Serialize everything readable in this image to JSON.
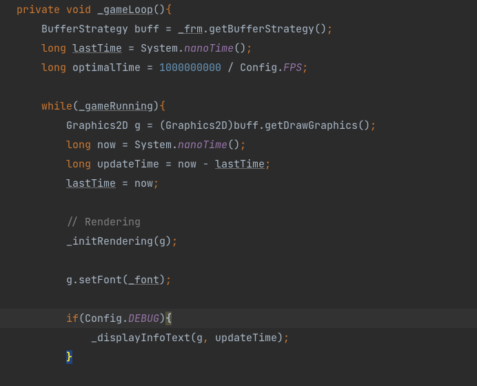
{
  "lines": [
    {
      "cls": "",
      "segs": [
        {
          "c": "kw",
          "t": "private "
        },
        {
          "c": "kw",
          "t": "void "
        },
        {
          "c": "mut",
          "t": "_gameLoop"
        },
        {
          "c": "plain",
          "t": "()"
        },
        {
          "c": "semi",
          "t": "{"
        }
      ]
    },
    {
      "cls": "",
      "segs": [
        {
          "c": "plain",
          "t": "    BufferStrategy buff = "
        },
        {
          "c": "field",
          "t": "_frm"
        },
        {
          "c": "plain",
          "t": ".getBufferStrategy()"
        },
        {
          "c": "semi",
          "t": ";"
        }
      ]
    },
    {
      "cls": "",
      "segs": [
        {
          "c": "plain",
          "t": "    "
        },
        {
          "c": "kw",
          "t": "long "
        },
        {
          "c": "mut",
          "t": "lastTime"
        },
        {
          "c": "plain",
          "t": " = System."
        },
        {
          "c": "static",
          "t": "nanoTime"
        },
        {
          "c": "plain",
          "t": "()"
        },
        {
          "c": "semi",
          "t": ";"
        }
      ]
    },
    {
      "cls": "",
      "segs": [
        {
          "c": "plain",
          "t": "    "
        },
        {
          "c": "kw",
          "t": "long "
        },
        {
          "c": "plain",
          "t": "optimalTime = "
        },
        {
          "c": "num",
          "t": "1000000000 "
        },
        {
          "c": "plain",
          "t": "/ Config."
        },
        {
          "c": "static",
          "t": "FPS"
        },
        {
          "c": "semi",
          "t": ";"
        }
      ]
    },
    {
      "cls": "",
      "segs": [
        {
          "c": "plain",
          "t": ""
        }
      ]
    },
    {
      "cls": "",
      "segs": [
        {
          "c": "plain",
          "t": "    "
        },
        {
          "c": "kw",
          "t": "while"
        },
        {
          "c": "plain",
          "t": "("
        },
        {
          "c": "field",
          "t": "_gameRunning"
        },
        {
          "c": "plain",
          "t": ")"
        },
        {
          "c": "semi",
          "t": "{"
        }
      ]
    },
    {
      "cls": "",
      "segs": [
        {
          "c": "plain",
          "t": "        Graphics2D g = (Graphics2D)buff.getDrawGraphics()"
        },
        {
          "c": "semi",
          "t": ";"
        }
      ]
    },
    {
      "cls": "",
      "segs": [
        {
          "c": "plain",
          "t": "        "
        },
        {
          "c": "kw",
          "t": "long "
        },
        {
          "c": "plain",
          "t": "now = System."
        },
        {
          "c": "static",
          "t": "nanoTime"
        },
        {
          "c": "plain",
          "t": "()"
        },
        {
          "c": "semi",
          "t": ";"
        }
      ]
    },
    {
      "cls": "",
      "segs": [
        {
          "c": "plain",
          "t": "        "
        },
        {
          "c": "kw",
          "t": "long "
        },
        {
          "c": "plain",
          "t": "updateTime = now - "
        },
        {
          "c": "mut",
          "t": "lastTime"
        },
        {
          "c": "semi",
          "t": ";"
        }
      ]
    },
    {
      "cls": "",
      "segs": [
        {
          "c": "plain",
          "t": "        "
        },
        {
          "c": "mut",
          "t": "lastTime"
        },
        {
          "c": "plain",
          "t": " = now"
        },
        {
          "c": "semi",
          "t": ";"
        }
      ]
    },
    {
      "cls": "",
      "segs": [
        {
          "c": "plain",
          "t": ""
        }
      ]
    },
    {
      "cls": "",
      "segs": [
        {
          "c": "plain",
          "t": "        "
        },
        {
          "c": "comment",
          "t": "// Rendering"
        }
      ]
    },
    {
      "cls": "",
      "segs": [
        {
          "c": "plain",
          "t": "        _initRendering(g)"
        },
        {
          "c": "semi",
          "t": ";"
        }
      ]
    },
    {
      "cls": "",
      "segs": [
        {
          "c": "plain",
          "t": ""
        }
      ]
    },
    {
      "cls": "",
      "segs": [
        {
          "c": "plain",
          "t": "        g.setFont("
        },
        {
          "c": "field",
          "t": "_font"
        },
        {
          "c": "plain",
          "t": ")"
        },
        {
          "c": "semi",
          "t": ";"
        }
      ]
    },
    {
      "cls": "",
      "segs": [
        {
          "c": "plain",
          "t": ""
        }
      ]
    },
    {
      "cls": "highlight",
      "segs": [
        {
          "c": "plain",
          "t": "        "
        },
        {
          "c": "kw",
          "t": "if"
        },
        {
          "c": "plain",
          "t": "(Config."
        },
        {
          "c": "static",
          "t": "DEBUG"
        },
        {
          "c": "plain",
          "t": ")"
        },
        {
          "c": "warnbrace",
          "t": "{"
        }
      ]
    },
    {
      "cls": "",
      "segs": [
        {
          "c": "plain",
          "t": "            _displayInfoText(g"
        },
        {
          "c": "semi",
          "t": ", "
        },
        {
          "c": "plain",
          "t": "updateTime)"
        },
        {
          "c": "semi",
          "t": ";"
        }
      ]
    },
    {
      "cls": "",
      "segs": [
        {
          "c": "plain",
          "t": "        "
        },
        {
          "c": "caret-brace",
          "t": "}"
        }
      ]
    },
    {
      "cls": "",
      "segs": [
        {
          "c": "plain",
          "t": ""
        }
      ]
    }
  ]
}
